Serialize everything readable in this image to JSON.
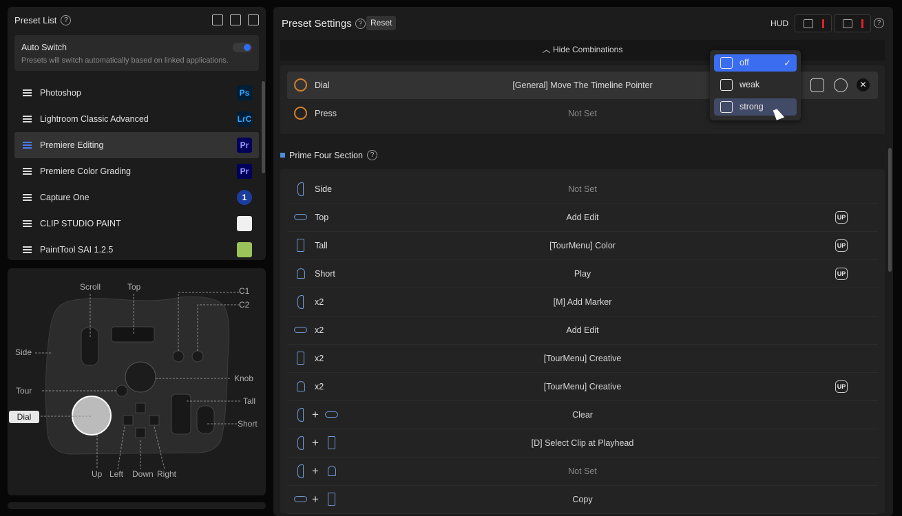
{
  "preset_list": {
    "title": "Preset List",
    "help": "?",
    "auto_switch": {
      "title": "Auto Switch",
      "desc": "Presets will switch automatically based on linked applications."
    },
    "items": [
      {
        "name": "Photoshop",
        "icon": "Ps",
        "color": "#31a8ff",
        "bg": "#001e36"
      },
      {
        "name": "Lightroom Classic Advanced",
        "icon": "LrC",
        "color": "#31a8ff",
        "bg": "#001e36"
      },
      {
        "name": "Premiere Editing",
        "icon": "Pr",
        "color": "#9999ff",
        "bg": "#00005b"
      },
      {
        "name": "Premiere Color Grading",
        "icon": "Pr",
        "color": "#9999ff",
        "bg": "#00005b"
      },
      {
        "name": "Capture One",
        "icon": "1",
        "color": "#ffffff",
        "bg": "#1b3d9e"
      },
      {
        "name": "CLIP STUDIO PAINT",
        "icon": "",
        "color": "#222",
        "bg": "#f0f0f0"
      },
      {
        "name": "PaintTool SAI 1.2.5",
        "icon": "",
        "color": "#222",
        "bg": "#9ac45a"
      }
    ]
  },
  "device": {
    "labels": {
      "scroll": "Scroll",
      "top": "Top",
      "c1": "C1",
      "c2": "C2",
      "side": "Side",
      "knob": "Knob",
      "tour": "Tour",
      "tall": "Tall",
      "dial": "Dial",
      "short": "Short",
      "up": "Up",
      "left": "Left",
      "down": "Down",
      "right": "Right"
    }
  },
  "settings": {
    "title": "Preset Settings",
    "reset": "Reset",
    "hud": "HUD",
    "hide_combinations": "Hide Combinations",
    "combo_rows": [
      {
        "label": "Dial",
        "action": "[General] Move The Timeline Pointer",
        "muted": false
      },
      {
        "label": "Press",
        "action": "Not Set",
        "muted": true
      }
    ],
    "haptic_dropdown": {
      "options": [
        {
          "label": "off",
          "selected": true
        },
        {
          "label": "weak",
          "selected": false
        },
        {
          "label": "strong",
          "selected": false
        }
      ]
    },
    "section_title": "Prime Four Section",
    "rows": [
      {
        "btn": "side",
        "label": "Side",
        "action": "Not Set",
        "muted": true,
        "up": ""
      },
      {
        "btn": "top",
        "label": "Top",
        "action": "Add Edit",
        "muted": false,
        "up": "UP"
      },
      {
        "btn": "tall",
        "label": "Tall",
        "action": "[TourMenu] Color",
        "muted": false,
        "up": "UP"
      },
      {
        "btn": "short",
        "label": "Short",
        "action": "Play",
        "muted": false,
        "up": "UP"
      },
      {
        "btn": "side",
        "label": "x2",
        "action": "[M] Add Marker",
        "muted": false,
        "up": ""
      },
      {
        "btn": "top",
        "label": "x2",
        "action": "Add Edit",
        "muted": false,
        "up": ""
      },
      {
        "btn": "tall",
        "label": "x2",
        "action": "[TourMenu] Creative",
        "muted": false,
        "up": ""
      },
      {
        "btn": "short",
        "label": "x2",
        "action": "[TourMenu] Creative",
        "muted": false,
        "up": "UP"
      },
      {
        "btn": "side+top",
        "label": "",
        "action": "Clear",
        "muted": false,
        "up": ""
      },
      {
        "btn": "side+tall",
        "label": "",
        "action": "[D] Select Clip at Playhead",
        "muted": false,
        "up": ""
      },
      {
        "btn": "side+short",
        "label": "",
        "action": "Not Set",
        "muted": true,
        "up": ""
      },
      {
        "btn": "top+tall",
        "label": "",
        "action": "Copy",
        "muted": false,
        "up": ""
      }
    ]
  }
}
